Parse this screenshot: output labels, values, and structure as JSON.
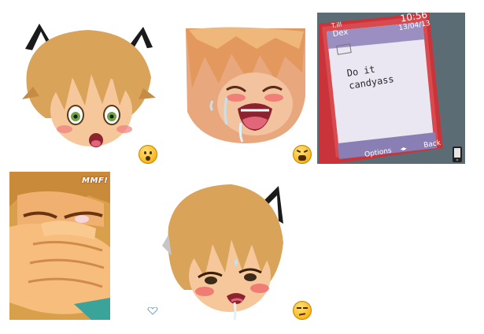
{
  "stickers": [
    {
      "name": "surprised-fox-boy",
      "emoji": "surprised-face"
    },
    {
      "name": "crying-boy",
      "emoji": "tired-face"
    },
    {
      "name": "phone-message",
      "emoji": ""
    },
    {
      "name": "hands-covering-face",
      "emoji": ""
    },
    {
      "name": "blushing-fox-boy",
      "emoji": "unamused-face"
    }
  ],
  "phone": {
    "carrier": "Dex",
    "signal_label": "T.ill",
    "time": "10:56",
    "date": "13/04/13",
    "message_line1": "Do it",
    "message_line2": "candyass",
    "softkey_left": "Options",
    "softkey_mid": "◂▸",
    "softkey_right": "Back"
  },
  "sfx_text": "MMF!",
  "colors": {
    "hair": "#d9a35a",
    "hair_dark": "#a86a2c",
    "skin": "#f5c79a",
    "blush": "#ef7d7d",
    "phone_red": "#c9343a",
    "screen": "#eae6f2"
  }
}
